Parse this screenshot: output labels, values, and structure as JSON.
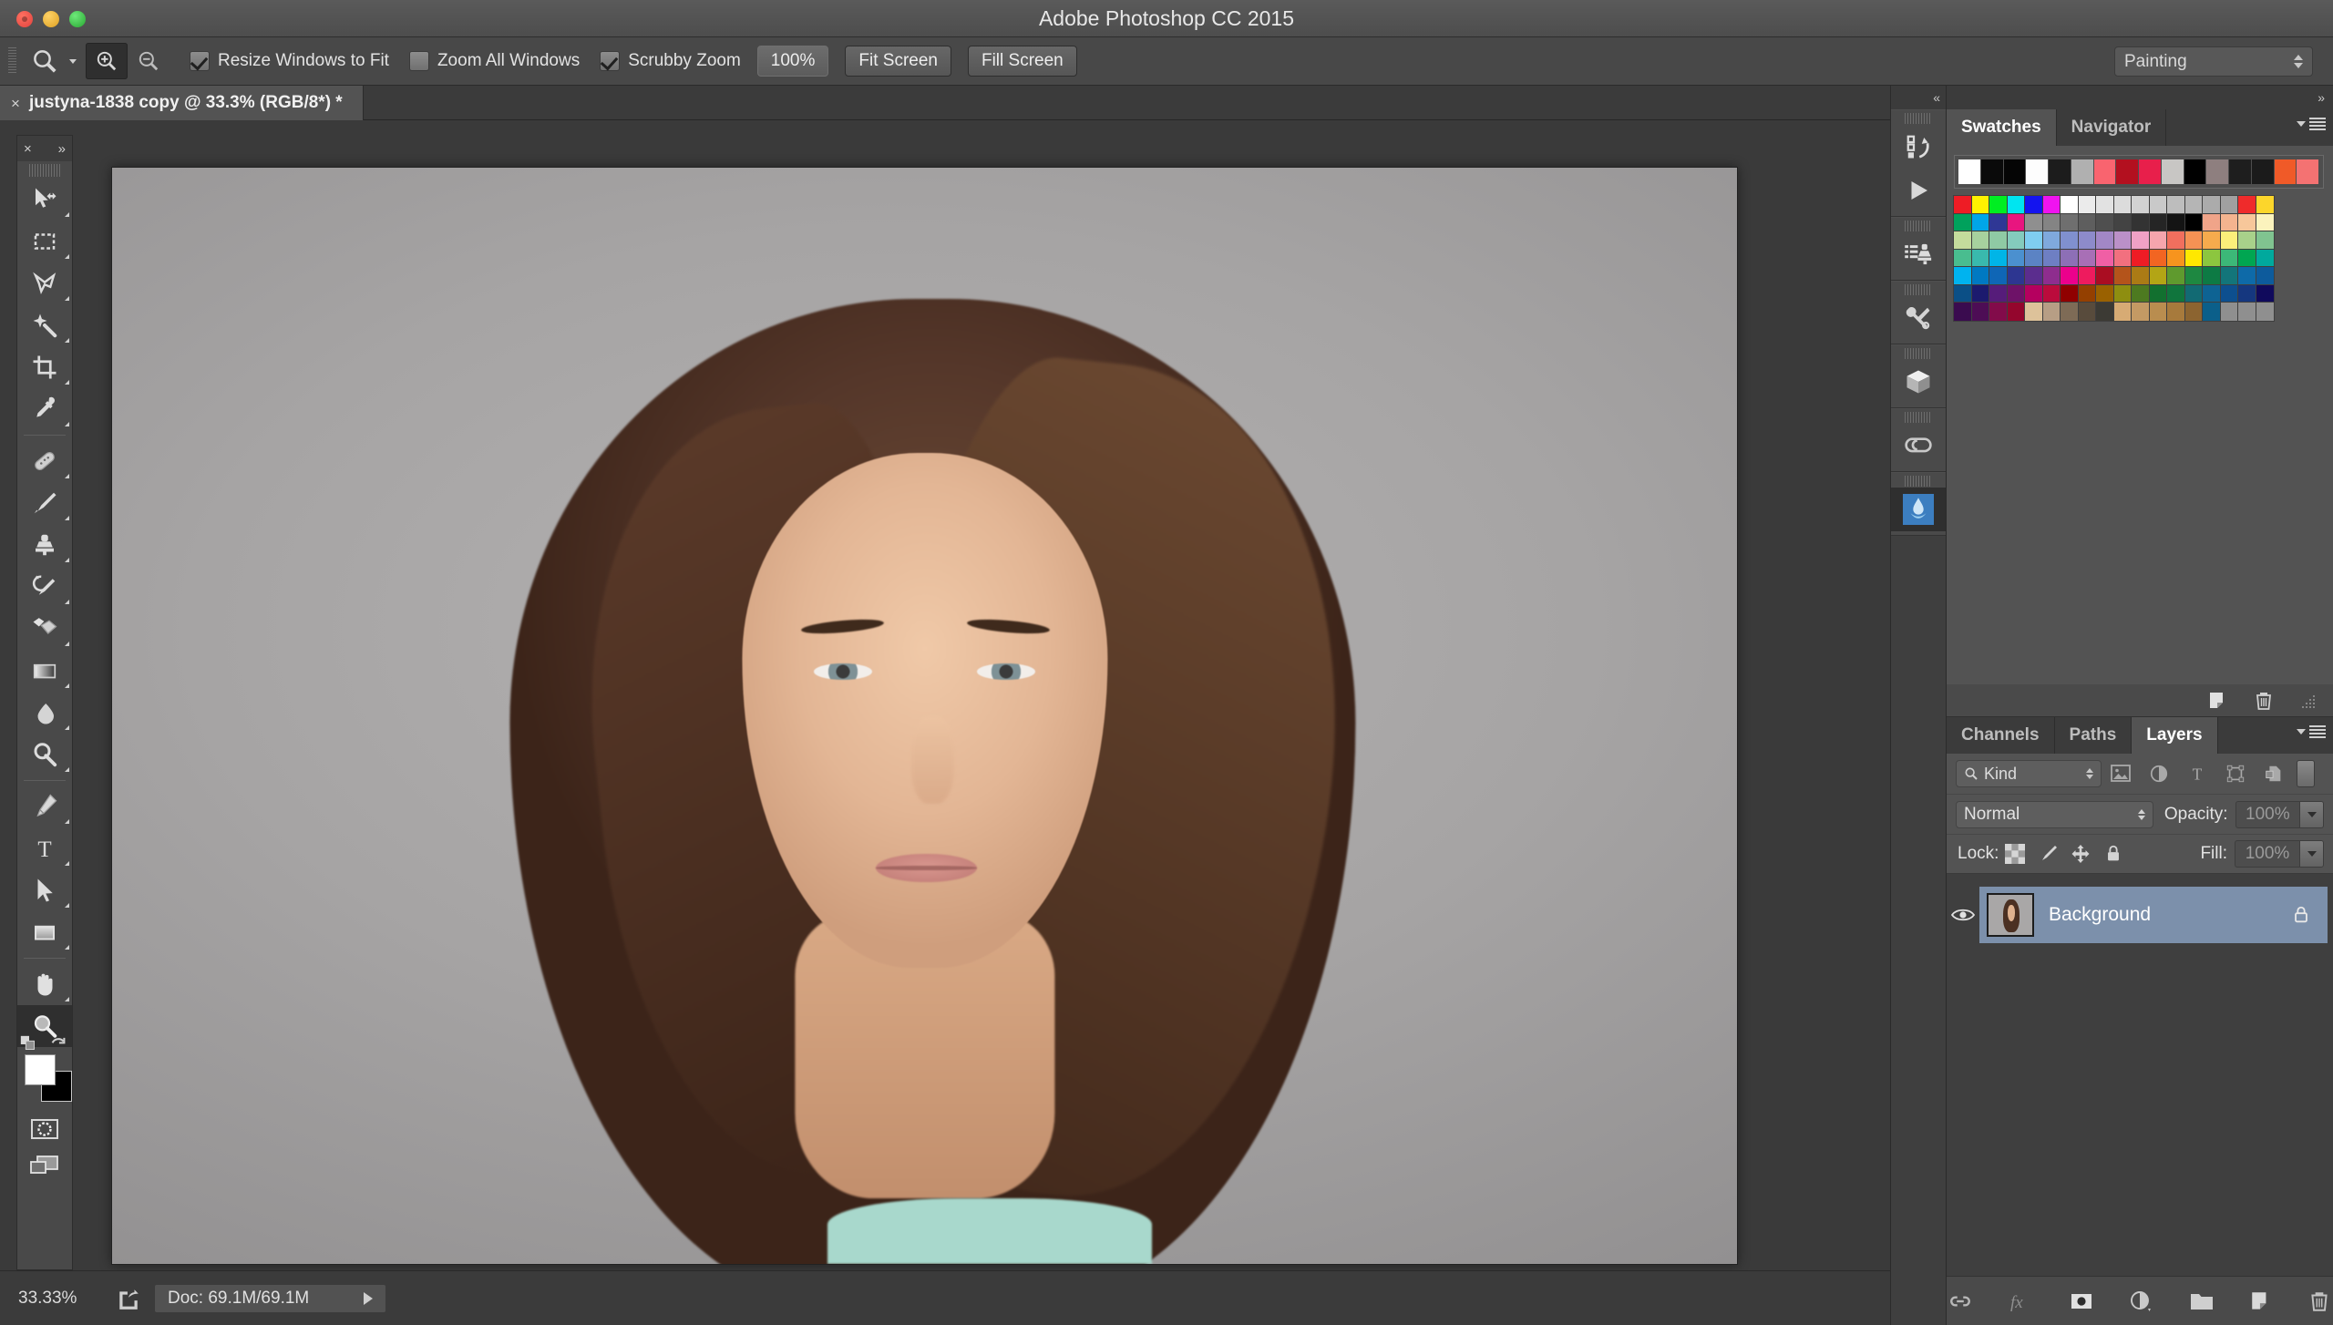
{
  "window": {
    "title": "Adobe Photoshop CC 2015",
    "traffic_lights": [
      "close",
      "minimize",
      "zoom"
    ]
  },
  "options_bar": {
    "active_tool_icon": "zoom-tool-icon",
    "tool_preset_caret": "chevron-down-icon",
    "zoom_in_icon": "zoom-in-icon",
    "zoom_out_icon": "zoom-out-icon",
    "checkboxes": [
      {
        "label": "Resize Windows to Fit",
        "checked": true,
        "name": "resize-windows-to-fit"
      },
      {
        "label": "Zoom All Windows",
        "checked": false,
        "name": "zoom-all-windows"
      },
      {
        "label": "Scrubby Zoom",
        "checked": true,
        "name": "scrubby-zoom"
      }
    ],
    "buttons": [
      {
        "label": "100%",
        "name": "zoom-100-button"
      },
      {
        "label": "Fit Screen",
        "name": "fit-screen-button"
      },
      {
        "label": "Fill Screen",
        "name": "fill-screen-button"
      }
    ],
    "workspace": {
      "value": "Painting"
    }
  },
  "document_tab": {
    "close_glyph": "×",
    "title": "justyna-1838 copy @ 33.3% (RGB/8*) *"
  },
  "toolbar": {
    "close_glyph": "×",
    "expand_glyph": "»",
    "tools": [
      {
        "name": "move-tool",
        "selected": false,
        "has_flyout": true
      },
      {
        "name": "rectangular-marquee-tool",
        "selected": false,
        "has_flyout": true
      },
      {
        "name": "lasso-tool",
        "selected": false,
        "has_flyout": true
      },
      {
        "name": "magic-wand-tool",
        "selected": false,
        "has_flyout": true
      },
      {
        "name": "crop-tool",
        "selected": false,
        "has_flyout": true
      },
      {
        "name": "eyedropper-tool",
        "selected": false,
        "has_flyout": true
      },
      {
        "name": "healing-brush-tool",
        "selected": false,
        "has_flyout": true
      },
      {
        "name": "brush-tool",
        "selected": false,
        "has_flyout": true
      },
      {
        "name": "clone-stamp-tool",
        "selected": false,
        "has_flyout": true
      },
      {
        "name": "history-brush-tool",
        "selected": false,
        "has_flyout": true
      },
      {
        "name": "eraser-tool",
        "selected": false,
        "has_flyout": true
      },
      {
        "name": "gradient-tool",
        "selected": false,
        "has_flyout": true
      },
      {
        "name": "blur-tool",
        "selected": false,
        "has_flyout": true
      },
      {
        "name": "dodge-tool",
        "selected": false,
        "has_flyout": true
      },
      {
        "name": "pen-tool",
        "selected": false,
        "has_flyout": true
      },
      {
        "name": "type-tool",
        "selected": false,
        "has_flyout": true
      },
      {
        "name": "path-selection-tool",
        "selected": false,
        "has_flyout": true
      },
      {
        "name": "rectangle-tool",
        "selected": false,
        "has_flyout": true
      },
      {
        "name": "hand-tool",
        "selected": false,
        "has_flyout": true
      },
      {
        "name": "zoom-tool",
        "selected": true,
        "has_flyout": false
      }
    ],
    "foreground_color": "#ffffff",
    "background_color": "#000000",
    "quick_mask_name": "quick-mask-toggle",
    "screen_mode_name": "screen-mode-toggle"
  },
  "icon_dock": {
    "collapse_glyph": "«",
    "groups": [
      {
        "icons": [
          "history-actions-icon",
          "play-icon"
        ]
      },
      {
        "icons": [
          "tool-presets-icon"
        ]
      },
      {
        "icons": [
          "adobe-tools-icon"
        ]
      },
      {
        "icons": [
          "3d-cube-icon"
        ]
      },
      {
        "icons": [
          "creative-cloud-icon"
        ]
      },
      {
        "icons": [
          "libraries-thumbnail-icon"
        ]
      }
    ]
  },
  "swatches_panel": {
    "collapse_glyph": "»",
    "tabs": [
      {
        "label": "Swatches",
        "active": true
      },
      {
        "label": "Navigator",
        "active": false
      }
    ],
    "recent_colors": [
      "#ffffff",
      "#0a0a0a",
      "#050505",
      "#fdfdfd",
      "#1c1c1c",
      "#b0b0b0",
      "#f9646f",
      "#b3101f",
      "#e81f4b",
      "#c8c6c4",
      "#000000",
      "#8e7f7f",
      "#1e1e1e",
      "#1b1b1b",
      "#f05a28",
      "#f47272"
    ],
    "swatch_rows": [
      [
        "#ee1c25",
        "#fff200",
        "#00ee22",
        "#00e5f0",
        "#1414ef",
        "#f013f0",
        "#ffffff",
        "#ebebeb",
        "#e2e2e2",
        "#dcdcdc",
        "#d2d2d2",
        "#c9c9c9",
        "#bdbdbd",
        "#b5b5b5",
        "#ababab",
        "#a0a0a0",
        "#ef2b2b",
        "#fcd62b"
      ],
      [
        "#00a15c",
        "#00a6e8",
        "#2f3795",
        "#e8157f",
        "#8f8f8f",
        "#848484",
        "#6f6f6f",
        "#5e5e5e",
        "#4f4f4f",
        "#434343",
        "#333333",
        "#252525",
        "#141414",
        "#000000",
        "#f0a489",
        "#f4b48f",
        "#f7c79a",
        "#fbf3bd"
      ],
      [
        "#c4dc9c",
        "#a7d19e",
        "#8fcaa4",
        "#84cbbd",
        "#7fcdf0",
        "#7fa9dd",
        "#8090cf",
        "#8d8bcb",
        "#a287c6",
        "#bb90c8",
        "#f0a1c5",
        "#f5a5ad",
        "#f16f5e",
        "#f59254",
        "#f6ab4d",
        "#fbef7a",
        "#a8d18a",
        "#80c490"
      ],
      [
        "#49bd8f",
        "#39b9ad",
        "#00b5e7",
        "#4b90cf",
        "#5b83c4",
        "#6e7fc3",
        "#8d6fb6",
        "#a86fb6",
        "#f05fa5",
        "#f2707f",
        "#ee1c25",
        "#f26522",
        "#f7941e",
        "#ffe800",
        "#8cc63f",
        "#3cb878",
        "#00a651",
        "#00a99d"
      ],
      [
        "#00b3ef",
        "#0079c2",
        "#0f66b6",
        "#2d3691",
        "#5b2d8e",
        "#8e2d8e",
        "#ec008c",
        "#ee1b5e",
        "#aa0d22",
        "#b4541b",
        "#ab7b15",
        "#b3a515",
        "#5f9a2e",
        "#1e8841",
        "#0d7a44",
        "#13757a",
        "#0e6aa8",
        "#0d5b9c"
      ],
      [
        "#0b4f86",
        "#1c1a6e",
        "#561c7a",
        "#6e1268",
        "#b5005f",
        "#bb0b3c",
        "#900000",
        "#944000",
        "#9a6100",
        "#8e8e10",
        "#4d7a20",
        "#12702f",
        "#10753d",
        "#126a73",
        "#0e6393",
        "#0d4f8f",
        "#15377f",
        "#100a5c"
      ],
      [
        "#3a0b4f",
        "#4d0d55",
        "#820b4a",
        "#94062d",
        "#ddc29a",
        "#b79e85",
        "#7e6b56",
        "#584b3c",
        "#3c3a34",
        "#d7ab74",
        "#c49a64",
        "#b98d4f",
        "#a77a3c",
        "#8c6430",
        "#0b5f8a",
        "#8f8f8f",
        "#8f8f8f",
        "#8f8f8f"
      ]
    ]
  },
  "layers_panel": {
    "header_icons": [
      "new-layer-icon",
      "delete-layer-icon",
      "panel-resize-icon"
    ],
    "tabs": [
      {
        "label": "Channels",
        "active": false
      },
      {
        "label": "Paths",
        "active": false
      },
      {
        "label": "Layers",
        "active": true
      }
    ],
    "filter": {
      "kind_label": "Kind",
      "search_icon": "search-icon",
      "type_filters": [
        "filter-pixel-icon",
        "filter-adjustment-icon",
        "filter-type-icon",
        "filter-shape-icon",
        "filter-smartobject-icon"
      ],
      "toggle_name": "filter-enable-toggle"
    },
    "blend": {
      "mode": "Normal",
      "opacity_label": "Opacity:",
      "opacity_value": "100%"
    },
    "lock": {
      "label": "Lock:",
      "icons": [
        "lock-transparent-pixels-icon",
        "lock-image-pixels-icon",
        "lock-position-icon",
        "lock-all-icon"
      ],
      "fill_label": "Fill:",
      "fill_value": "100%"
    },
    "layers": [
      {
        "name": "Background",
        "visible": true,
        "locked": true,
        "selected": true
      }
    ],
    "footer_icons": [
      "link-layers-icon",
      "layer-style-fx-icon",
      "layer-mask-icon",
      "adjustment-layer-icon",
      "new-group-icon",
      "new-layer-icon",
      "delete-layer-icon"
    ]
  },
  "status_bar": {
    "zoom": "33.33%",
    "share_icon": "share-icon",
    "doc_info": "Doc: 69.1M/69.1M",
    "arrow_icon": "play-arrow-icon"
  },
  "colors": {
    "chrome": "#484848",
    "panel": "#535353",
    "canvas_bg": "#3a3a3a",
    "layer_selected": "#7c90ab",
    "text": "#e8e8e8"
  }
}
